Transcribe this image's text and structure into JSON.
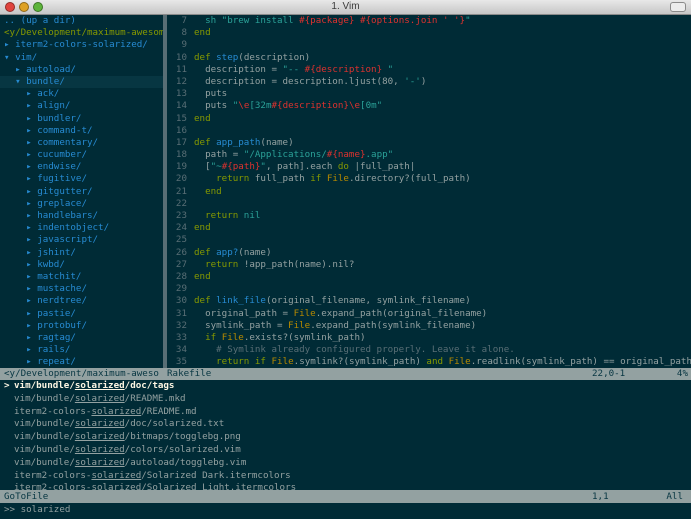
{
  "window": {
    "title": "1. Vim"
  },
  "tree": {
    "lines": [
      {
        "text": ".. (up a dir)",
        "kind": "updir"
      },
      {
        "text": "<y/Development/maximum-awesome/",
        "kind": "cwd"
      },
      {
        "text": "▸ iterm2-colors-solarized/",
        "kind": "dir"
      },
      {
        "text": "▾ vim/",
        "kind": "dir"
      },
      {
        "text": "  ▸ autoload/",
        "kind": "dir"
      },
      {
        "text": "  ▾ bundle/",
        "kind": "selected"
      },
      {
        "text": "    ▸ ack/",
        "kind": "dir"
      },
      {
        "text": "    ▸ align/",
        "kind": "dir"
      },
      {
        "text": "    ▸ bundler/",
        "kind": "dir"
      },
      {
        "text": "    ▸ command-t/",
        "kind": "dir"
      },
      {
        "text": "    ▸ commentary/",
        "kind": "dir"
      },
      {
        "text": "    ▸ cucumber/",
        "kind": "dir"
      },
      {
        "text": "    ▸ endwise/",
        "kind": "dir"
      },
      {
        "text": "    ▸ fugitive/",
        "kind": "dir"
      },
      {
        "text": "    ▸ gitgutter/",
        "kind": "dir"
      },
      {
        "text": "    ▸ greplace/",
        "kind": "dir"
      },
      {
        "text": "    ▸ handlebars/",
        "kind": "dir"
      },
      {
        "text": "    ▸ indentobject/",
        "kind": "dir"
      },
      {
        "text": "    ▸ javascript/",
        "kind": "dir"
      },
      {
        "text": "    ▸ jshint/",
        "kind": "dir"
      },
      {
        "text": "    ▸ kwbd/",
        "kind": "dir"
      },
      {
        "text": "    ▸ matchit/",
        "kind": "dir"
      },
      {
        "text": "    ▸ mustache/",
        "kind": "dir"
      },
      {
        "text": "    ▸ nerdtree/",
        "kind": "dir"
      },
      {
        "text": "    ▸ pastie/",
        "kind": "dir"
      },
      {
        "text": "    ▸ protobuf/",
        "kind": "dir"
      },
      {
        "text": "    ▸ ragtag/",
        "kind": "dir"
      },
      {
        "text": "    ▸ rails/",
        "kind": "dir"
      },
      {
        "text": "    ▸ repeat/",
        "kind": "dir"
      }
    ]
  },
  "code": {
    "lines": [
      {
        "num": "7",
        "tokens": [
          [
            "  sh \"brew install ",
            "#2aa198"
          ],
          [
            "#{package}",
            "#dc322f"
          ],
          [
            " ",
            "#2aa198"
          ],
          [
            "#{options.join ' '}",
            "#dc322f"
          ],
          [
            "\"",
            "#2aa198"
          ]
        ]
      },
      {
        "num": "8",
        "tokens": [
          [
            "end",
            "#859900"
          ]
        ]
      },
      {
        "num": "9",
        "tokens": []
      },
      {
        "num": "10",
        "tokens": [
          [
            "def ",
            "#859900"
          ],
          [
            "step",
            "#268bd2"
          ],
          [
            "(description)",
            "#93a1a1"
          ]
        ]
      },
      {
        "num": "11",
        "tokens": [
          [
            "  description = ",
            "#93a1a1"
          ],
          [
            "\"-- ",
            "#2aa198"
          ],
          [
            "#{description}",
            "#dc322f"
          ],
          [
            " \"",
            "#2aa198"
          ]
        ]
      },
      {
        "num": "12",
        "tokens": [
          [
            "  description = description.ljust(80, ",
            "#93a1a1"
          ],
          [
            "'-'",
            "#2aa198"
          ],
          [
            ")",
            "#93a1a1"
          ]
        ]
      },
      {
        "num": "13",
        "tokens": [
          [
            "  puts",
            "#93a1a1"
          ]
        ]
      },
      {
        "num": "14",
        "tokens": [
          [
            "  puts ",
            "#93a1a1"
          ],
          [
            "\"",
            "#2aa198"
          ],
          [
            "\\e",
            "#dc322f"
          ],
          [
            "[32m",
            "#2aa198"
          ],
          [
            "#{description}",
            "#dc322f"
          ],
          [
            "\\e",
            "#dc322f"
          ],
          [
            "[0m\"",
            "#2aa198"
          ]
        ]
      },
      {
        "num": "15",
        "tokens": [
          [
            "end",
            "#859900"
          ]
        ]
      },
      {
        "num": "16",
        "tokens": []
      },
      {
        "num": "17",
        "tokens": [
          [
            "def ",
            "#859900"
          ],
          [
            "app_path",
            "#268bd2"
          ],
          [
            "(name)",
            "#93a1a1"
          ]
        ]
      },
      {
        "num": "18",
        "tokens": [
          [
            "  path = ",
            "#93a1a1"
          ],
          [
            "\"/Applications/",
            "#2aa198"
          ],
          [
            "#{name}",
            "#dc322f"
          ],
          [
            ".app\"",
            "#2aa198"
          ]
        ]
      },
      {
        "num": "19",
        "tokens": [
          [
            "  [",
            "#93a1a1"
          ],
          [
            "\"~",
            "#2aa198"
          ],
          [
            "#{path}",
            "#dc322f"
          ],
          [
            "\"",
            "#2aa198"
          ],
          [
            ", path].each ",
            "#93a1a1"
          ],
          [
            "do",
            "#859900"
          ],
          [
            " |full_path|",
            "#93a1a1"
          ]
        ]
      },
      {
        "num": "20",
        "tokens": [
          [
            "    ",
            "#93a1a1"
          ],
          [
            "return",
            "#859900"
          ],
          [
            " full_path ",
            "#93a1a1"
          ],
          [
            "if",
            "#859900"
          ],
          [
            " ",
            "#93a1a1"
          ],
          [
            "File",
            "#b58900"
          ],
          [
            ".directory?(full_path)",
            "#93a1a1"
          ]
        ]
      },
      {
        "num": "21",
        "tokens": [
          [
            "  end",
            "#859900"
          ]
        ]
      },
      {
        "num": "22",
        "tokens": []
      },
      {
        "num": "23",
        "tokens": [
          [
            "  return",
            "#859900"
          ],
          [
            " nil",
            "#2aa198"
          ]
        ]
      },
      {
        "num": "24",
        "tokens": [
          [
            "end",
            "#859900"
          ]
        ]
      },
      {
        "num": "25",
        "tokens": []
      },
      {
        "num": "26",
        "tokens": [
          [
            "def ",
            "#859900"
          ],
          [
            "app?",
            "#268bd2"
          ],
          [
            "(name)",
            "#93a1a1"
          ]
        ]
      },
      {
        "num": "27",
        "tokens": [
          [
            "  ",
            "#93a1a1"
          ],
          [
            "return",
            "#859900"
          ],
          [
            " !app_path(name).nil?",
            "#93a1a1"
          ]
        ]
      },
      {
        "num": "28",
        "tokens": [
          [
            "end",
            "#859900"
          ]
        ]
      },
      {
        "num": "29",
        "tokens": []
      },
      {
        "num": "30",
        "tokens": [
          [
            "def ",
            "#859900"
          ],
          [
            "link_file",
            "#268bd2"
          ],
          [
            "(original_filename, symlink_filename)",
            "#93a1a1"
          ]
        ]
      },
      {
        "num": "31",
        "tokens": [
          [
            "  original_path = ",
            "#93a1a1"
          ],
          [
            "File",
            "#b58900"
          ],
          [
            ".expand_path(original_filename)",
            "#93a1a1"
          ]
        ]
      },
      {
        "num": "32",
        "tokens": [
          [
            "  symlink_path = ",
            "#93a1a1"
          ],
          [
            "File",
            "#b58900"
          ],
          [
            ".expand_path(symlink_filename)",
            "#93a1a1"
          ]
        ]
      },
      {
        "num": "33",
        "tokens": [
          [
            "  ",
            "#93a1a1"
          ],
          [
            "if",
            "#859900"
          ],
          [
            " ",
            "#93a1a1"
          ],
          [
            "File",
            "#b58900"
          ],
          [
            ".exists?(symlink_path)",
            "#93a1a1"
          ]
        ]
      },
      {
        "num": "34",
        "tokens": [
          [
            "    # Symlink already configured properly. Leave it alone.",
            "#586e75"
          ]
        ]
      },
      {
        "num": "35",
        "tokens": [
          [
            "    ",
            "#93a1a1"
          ],
          [
            "return",
            "#859900"
          ],
          [
            " ",
            "#93a1a1"
          ],
          [
            "if",
            "#859900"
          ],
          [
            " ",
            "#93a1a1"
          ],
          [
            "File",
            "#b58900"
          ],
          [
            ".symlink?(symlink_path) ",
            "#93a1a1"
          ],
          [
            "and",
            "#859900"
          ],
          [
            " ",
            "#93a1a1"
          ],
          [
            "File",
            "#b58900"
          ],
          [
            ".readlink(symlink_path) == original_path",
            "#93a1a1"
          ]
        ]
      }
    ]
  },
  "statusline": {
    "left": "<y/Development/maximum-awesome",
    "file": "Rakefile",
    "pos": "22,0-1",
    "pct": "4%"
  },
  "results": {
    "cursor": ">",
    "items": [
      {
        "before": "vim/bundle/",
        "match": "solarized",
        "after": "/doc/tags",
        "selected": true
      },
      {
        "before": "vim/bundle/",
        "match": "solarized",
        "after": "/README.mkd",
        "selected": false
      },
      {
        "before": "iterm2-colors-",
        "match": "solarized",
        "after": "/README.md",
        "selected": false
      },
      {
        "before": "vim/bundle/",
        "match": "solarized",
        "after": "/doc/solarized.txt",
        "selected": false
      },
      {
        "before": "vim/bundle/",
        "match": "solarized",
        "after": "/bitmaps/togglebg.png",
        "selected": false
      },
      {
        "before": "vim/bundle/",
        "match": "solarized",
        "after": "/colors/solarized.vim",
        "selected": false
      },
      {
        "before": "vim/bundle/",
        "match": "solarized",
        "after": "/autoload/togglebg.vim",
        "selected": false
      },
      {
        "before": "iterm2-colors-",
        "match": "solarized",
        "after": "/Solarized Dark.itermcolors",
        "selected": false
      },
      {
        "before": "iterm2-colors-",
        "match": "solarized",
        "after": "/Solarized Light.itermcolors",
        "selected": false
      }
    ]
  },
  "statusline2": {
    "left": "GoToFile",
    "pos": "1,1",
    "pct": "All"
  },
  "cmdline": {
    "prompt": ">> ",
    "value": "solarized"
  }
}
